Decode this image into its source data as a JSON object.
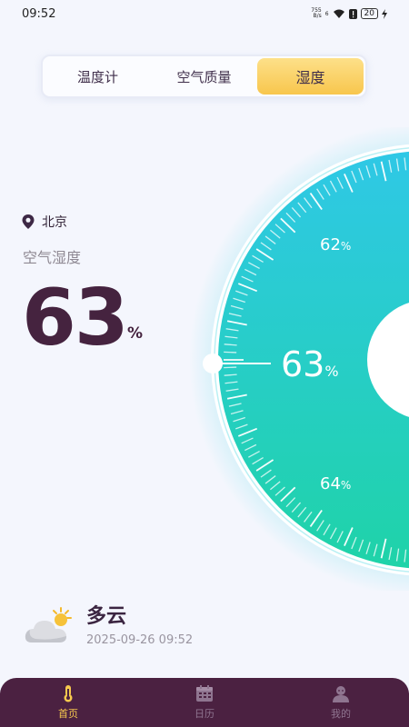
{
  "status": {
    "time": "09:52",
    "netspeed_top": "755",
    "netspeed_bottom": "B/s",
    "signal": "6",
    "battery": "20"
  },
  "tabs": [
    {
      "label": "温度计",
      "active": false
    },
    {
      "label": "空气质量",
      "active": false
    },
    {
      "label": "湿度",
      "active": true
    }
  ],
  "location": "北京",
  "metric": {
    "label": "空气湿度",
    "value": "63",
    "unit": "%"
  },
  "gauge": {
    "current": "63",
    "prev": "62",
    "next": "64",
    "unit": "%",
    "color_top": "#2fc8e6",
    "color_bottom": "#1fd3a8"
  },
  "weather": {
    "condition": "多云",
    "datetime": "2025-09-26 09:52",
    "icon": "partly-cloudy-icon"
  },
  "nav": [
    {
      "label": "首页",
      "icon": "thermometer-icon",
      "active": true
    },
    {
      "label": "日历",
      "icon": "calendar-icon",
      "active": false
    },
    {
      "label": "我的",
      "icon": "user-icon",
      "active": false
    }
  ],
  "colors": {
    "accent": "#f8c64d",
    "nav_bg": "#4b2141",
    "text_dark": "#45233f"
  }
}
